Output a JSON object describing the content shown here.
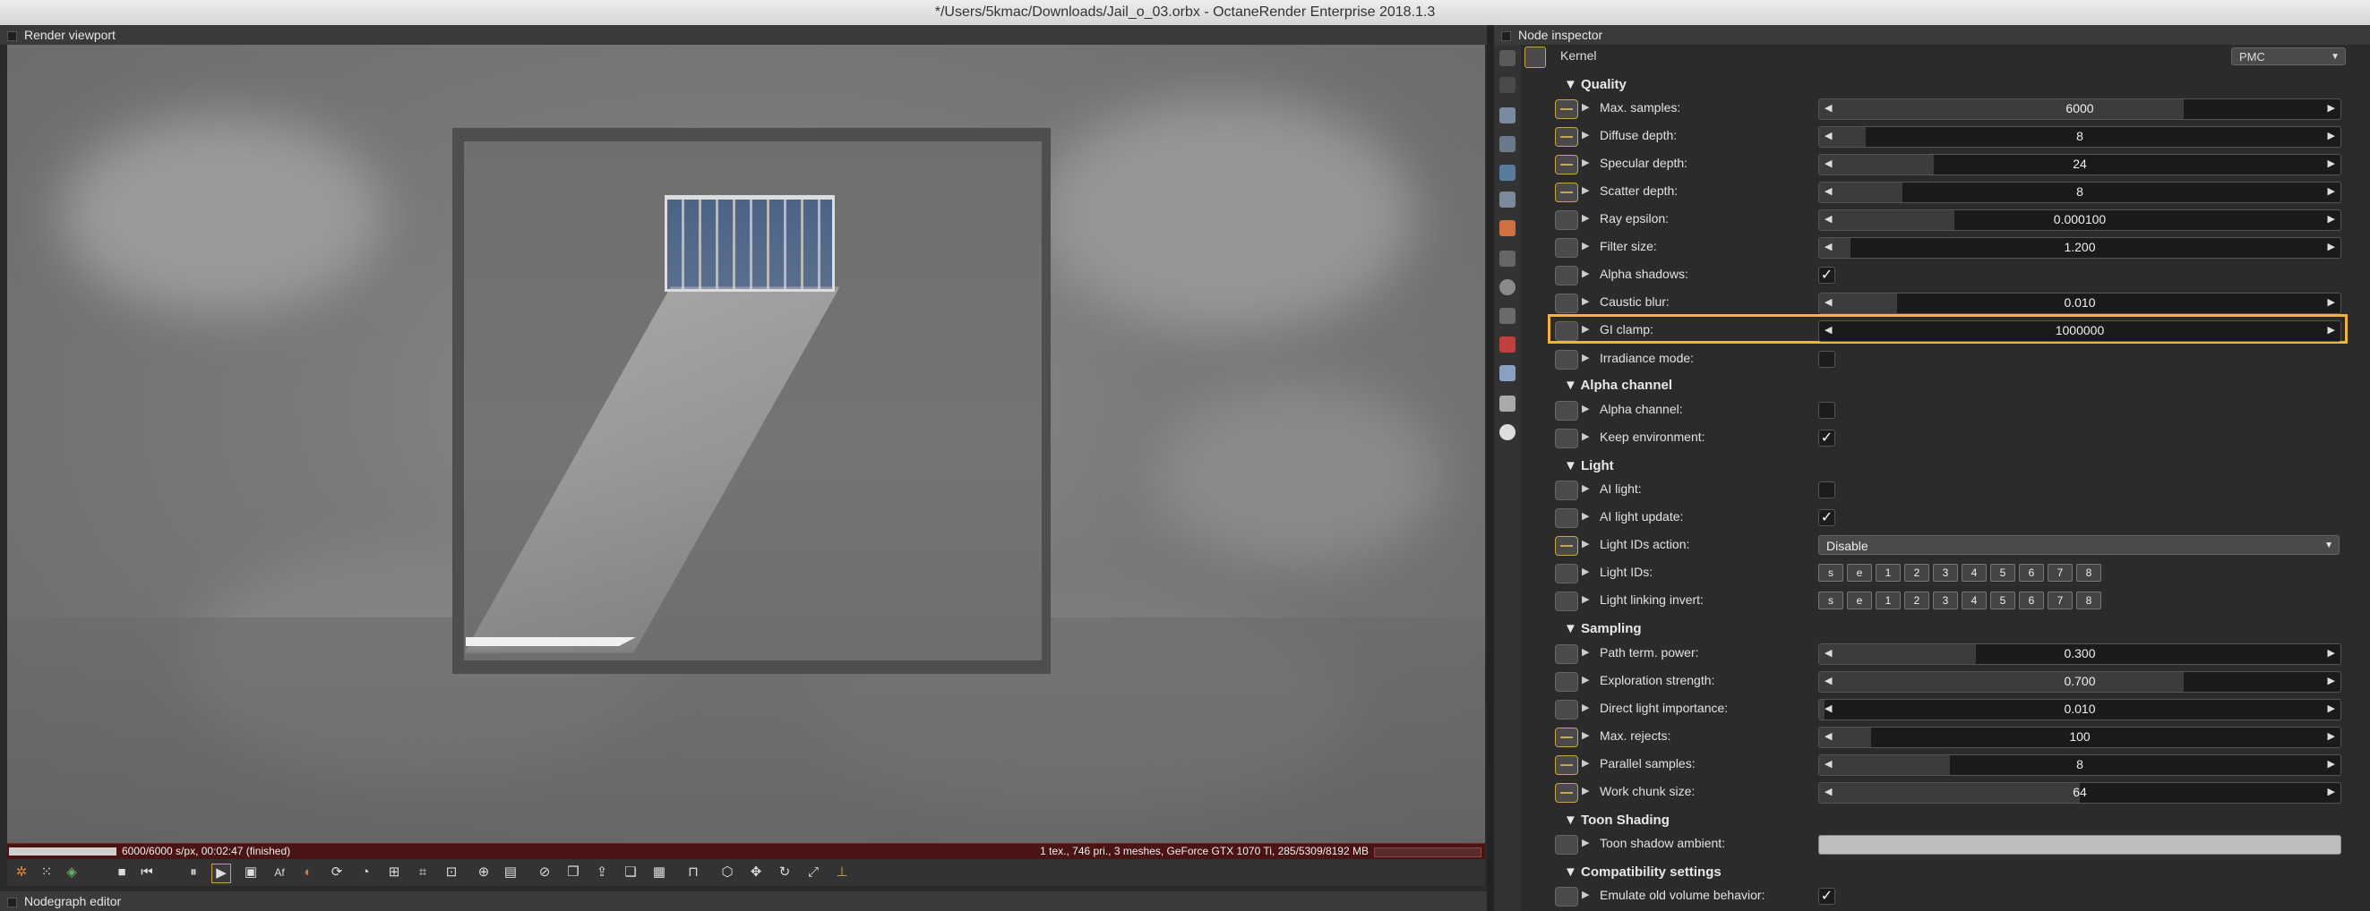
{
  "window": {
    "title": "*/Users/5kmac/Downloads/Jail_o_03.orbx - OctaneRender Enterprise 2018.1.3"
  },
  "panels": {
    "render_viewport": "Render viewport",
    "node_inspector": "Node inspector",
    "nodegraph_editor": "Nodegraph editor"
  },
  "status": {
    "left": "6000/6000 s/px, 00:02:47 (finished)",
    "right": "1 tex., 746 pri., 3 meshes, GeForce GTX 1070 Ti, 285/5309/8192 MB",
    "progress": 1.0
  },
  "kernel": {
    "label": "Kernel",
    "value": "PMC"
  },
  "sections": {
    "quality": "Quality",
    "alpha": "Alpha channel",
    "light": "Light",
    "sampling": "Sampling",
    "toon": "Toon Shading",
    "compat": "Compatibility settings"
  },
  "rows": {
    "max_samples": {
      "label": "Max. samples:",
      "value": "6000",
      "fill": 0.7
    },
    "diffuse_depth": {
      "label": "Diffuse depth:",
      "value": "8",
      "fill": 0.09
    },
    "specular_depth": {
      "label": "Specular depth:",
      "value": "24",
      "fill": 0.22
    },
    "scatter_depth": {
      "label": "Scatter depth:",
      "value": "8",
      "fill": 0.16
    },
    "ray_epsilon": {
      "label": "Ray epsilon:",
      "value": "0.000100",
      "fill": 0.26
    },
    "filter_size": {
      "label": "Filter size:",
      "value": "1.200",
      "fill": 0.06
    },
    "alpha_shadows": {
      "label": "Alpha shadows:",
      "checked": "✓"
    },
    "caustic_blur": {
      "label": "Caustic blur:",
      "value": "0.010",
      "fill": 0.15
    },
    "gi_clamp": {
      "label": "GI clamp:",
      "value": "1000000",
      "fill": 0.0
    },
    "irradiance_mode": {
      "label": "Irradiance mode:",
      "checked": ""
    },
    "alpha_channel": {
      "label": "Alpha channel:",
      "checked": ""
    },
    "keep_environment": {
      "label": "Keep environment:",
      "checked": "✓"
    },
    "ai_light": {
      "label": "AI light:",
      "checked": ""
    },
    "ai_light_update": {
      "label": "AI light update:",
      "checked": "✓"
    },
    "light_ids_action": {
      "label": "Light IDs action:",
      "value": "Disable"
    },
    "light_ids": {
      "label": "Light IDs:"
    },
    "light_linking_invert": {
      "label": "Light linking invert:"
    },
    "path_term_power": {
      "label": "Path term. power:",
      "value": "0.300",
      "fill": 0.3
    },
    "exploration_strength": {
      "label": "Exploration strength:",
      "value": "0.700",
      "fill": 0.7
    },
    "direct_light_importance": {
      "label": "Direct light importance:",
      "value": "0.010",
      "fill": 0.01
    },
    "max_rejects": {
      "label": "Max. rejects:",
      "value": "100",
      "fill": 0.1
    },
    "parallel_samples": {
      "label": "Parallel samples:",
      "value": "8",
      "fill": 0.25
    },
    "work_chunk_size": {
      "label": "Work chunk size:",
      "value": "64",
      "fill": 0.5
    },
    "toon_shadow_ambient": {
      "label": "Toon shadow ambient:"
    },
    "emulate_old_volume": {
      "label": "Emulate old volume behavior:",
      "checked": "✓"
    }
  },
  "id_buttons": [
    "s",
    "e",
    "1",
    "2",
    "3",
    "4",
    "5",
    "6",
    "7",
    "8"
  ],
  "colors": {
    "accent": "#f0b43c",
    "status_bar": "#4a1414"
  }
}
